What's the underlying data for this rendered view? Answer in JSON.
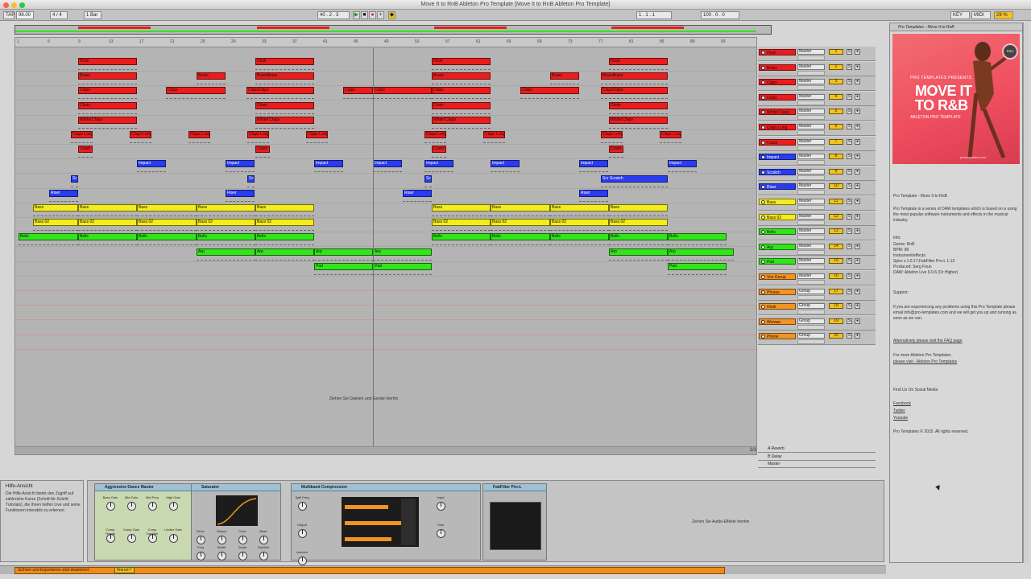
{
  "window": {
    "title": "Move It to RnB Ableton Pro Template  [Move It to RnB Ableton Pro Template]"
  },
  "transport": {
    "tap": "TAP",
    "tempo": "98.00",
    "meter": "4 / 4",
    "quantize": "1 Bar",
    "position": "40 . 2 . 3",
    "loop_start": "1 . 1 . 1",
    "loop_length": "100 . 0 . 0",
    "key": "KEY",
    "midi": "MIDI",
    "cpu": "29 %"
  },
  "colors": {
    "red": "#ec1c1c",
    "blue": "#2a3cf0",
    "yellow": "#f4ec1c",
    "green": "#33e31c",
    "orange": "#f29322"
  },
  "ruler_ticks": [
    "1",
    "5",
    "9",
    "13",
    "17",
    "21",
    "25",
    "29",
    "33",
    "37",
    "41",
    "45",
    "49",
    "53",
    "57",
    "61",
    "65",
    "69",
    "73",
    "77",
    "81",
    "85",
    "89",
    "93"
  ],
  "clips_by_track": [
    [
      [
        "Hook",
        96,
        169
      ],
      [
        "Hook",
        316,
        389
      ],
      [
        "Hook",
        535,
        608
      ],
      [
        "Hook",
        755,
        828
      ]
    ],
    [
      [
        "Brass",
        96,
        169
      ],
      [
        "Brass",
        243,
        279
      ],
      [
        "BrassBrass",
        316,
        389
      ],
      [
        "Brass",
        535,
        608
      ],
      [
        "Brass",
        682,
        718
      ],
      [
        "BrassBrass",
        745,
        828
      ]
    ],
    [
      [
        "Claps",
        96,
        169
      ],
      [
        "Claps",
        205,
        279
      ],
      [
        "ClapsClaps",
        305,
        389
      ],
      [
        "Claps",
        425,
        462
      ],
      [
        "Claps",
        462,
        535
      ],
      [
        "Claps",
        535,
        608
      ],
      [
        "Claps",
        645,
        718
      ],
      [
        "ClapsClaps",
        745,
        828
      ]
    ],
    [
      [
        "Chois",
        96,
        169
      ],
      [
        "Chois",
        316,
        389
      ],
      [
        "Chois",
        535,
        608
      ],
      [
        "Chois",
        755,
        828
      ]
    ],
    [
      [
        "Whitel Claps",
        96,
        169
      ],
      [
        "Whitel Claps",
        316,
        389
      ],
      [
        "Whitel Claps",
        535,
        608
      ],
      [
        "Whitel Claps",
        755,
        828
      ]
    ],
    [
      [
        "Claps Long",
        87,
        114
      ],
      [
        "Claps Long",
        160,
        187
      ],
      [
        "Claps Long",
        233,
        260
      ],
      [
        "Claps Long",
        306,
        333
      ],
      [
        "Claps Long",
        379,
        406
      ],
      [
        "Claps Long",
        526,
        553
      ],
      [
        "Claps Long",
        599,
        626
      ],
      [
        "Claps Long",
        745,
        772
      ],
      [
        "Claps Long",
        818,
        845
      ]
    ],
    [
      [
        "Crash",
        96,
        114
      ],
      [
        "Crash",
        316,
        334
      ],
      [
        "Crash",
        535,
        553
      ],
      [
        "Crash",
        755,
        773
      ]
    ],
    [
      [
        "Impact",
        169,
        205
      ],
      [
        "Impact",
        279,
        315
      ],
      [
        "Impact",
        389,
        425
      ],
      [
        "Impact",
        462,
        498
      ],
      [
        "Impact",
        526,
        562
      ],
      [
        "Impact",
        608,
        644
      ],
      [
        "Impact",
        718,
        754
      ],
      [
        "Impact",
        828,
        864
      ]
    ],
    [
      [
        "Scr",
        87,
        96
      ],
      [
        "Scr",
        306,
        315
      ],
      [
        "Scr",
        526,
        535
      ],
      [
        "Scr Scratch",
        745,
        828
      ]
    ],
    [
      [
        "Riser",
        60,
        96
      ],
      [
        "Riser",
        279,
        315
      ],
      [
        "Riser",
        499,
        535
      ],
      [
        "Riser",
        718,
        754
      ]
    ],
    [
      [
        "Bass",
        40,
        96
      ],
      [
        "Bass",
        96,
        169
      ],
      [
        "Bass",
        169,
        243
      ],
      [
        "Bass",
        243,
        316
      ],
      [
        "Bass",
        316,
        389
      ],
      [
        "Bass",
        535,
        608
      ],
      [
        "Bass",
        608,
        682
      ],
      [
        "Bass",
        682,
        755
      ],
      [
        "Bass",
        755,
        828
      ]
    ],
    [
      [
        "Bass 02",
        40,
        96
      ],
      [
        "Bass 02",
        96,
        169
      ],
      [
        "Bass 02",
        169,
        243
      ],
      [
        "Bass 02",
        243,
        316
      ],
      [
        "Bass 02",
        316,
        389
      ],
      [
        "Bass 02",
        535,
        608
      ],
      [
        "Bass 02",
        608,
        682
      ],
      [
        "Bass 02",
        682,
        755
      ],
      [
        "Bass 02",
        755,
        828
      ]
    ],
    [
      [
        "Bells",
        22,
        96
      ],
      [
        "Bells",
        96,
        169
      ],
      [
        "Bells",
        169,
        243
      ],
      [
        "Bells",
        243,
        316
      ],
      [
        "Bells",
        316,
        389
      ],
      [
        "Bells",
        535,
        608
      ],
      [
        "Bells",
        608,
        682
      ],
      [
        "Bells",
        682,
        755
      ],
      [
        "Bells",
        755,
        828
      ],
      [
        "Bells",
        828,
        901
      ]
    ],
    [
      [
        "Arp",
        243,
        316
      ],
      [
        "Arp",
        316,
        389
      ],
      [
        "Arp",
        389,
        462
      ],
      [
        "Arp",
        462,
        535
      ],
      [
        "Arp",
        755,
        828
      ],
      [
        "Arp",
        828,
        910
      ]
    ],
    [
      [
        "Pad",
        389,
        462
      ],
      [
        "Pad",
        462,
        535
      ],
      [
        "Pad",
        828,
        901
      ]
    ]
  ],
  "tracks": [
    {
      "name": "Hook",
      "color": "#ec1c1c",
      "route": "Master",
      "num": "1"
    },
    {
      "name": "Brass",
      "color": "#ec1c1c",
      "route": "Master",
      "num": "2"
    },
    {
      "name": "Claps",
      "color": "#ec1c1c",
      "route": "Master",
      "num": "3"
    },
    {
      "name": "Chois",
      "color": "#ec1c1c",
      "route": "Master",
      "num": "4"
    },
    {
      "name": "Whitel Claps",
      "color": "#ec1c1c",
      "route": "Master",
      "num": "5"
    },
    {
      "name": "Claps Long",
      "color": "#ec1c1c",
      "route": "Master",
      "num": "6"
    },
    {
      "name": "Crash",
      "color": "#ec1c1c",
      "route": "Master",
      "num": "7"
    },
    {
      "name": "Impact",
      "color": "#2a3cf0",
      "route": "Master",
      "num": "8"
    },
    {
      "name": "Scratch",
      "color": "#2a3cf0",
      "route": "Master",
      "num": "9"
    },
    {
      "name": "Riser",
      "color": "#2a3cf0",
      "route": "Master",
      "num": "10"
    },
    {
      "name": "Bass",
      "color": "#f4ec1c",
      "route": "Master",
      "num": "11"
    },
    {
      "name": "Bass 02",
      "color": "#f4ec1c",
      "route": "Master",
      "num": "12"
    },
    {
      "name": "Bells",
      "color": "#33e31c",
      "route": "Master",
      "num": "13"
    },
    {
      "name": "Arp",
      "color": "#33e31c",
      "route": "Master",
      "num": "14"
    },
    {
      "name": "Pad",
      "color": "#33e31c",
      "route": "Master",
      "num": "15"
    },
    {
      "name": "Vox Group",
      "color": "#f29322",
      "route": "Master",
      "num": "16"
    },
    {
      "name": "Phrase",
      "color": "#f29322",
      "route": "Group",
      "num": "17"
    },
    {
      "name": "Hook",
      "color": "#f29322",
      "route": "Group",
      "num": "18"
    },
    {
      "name": "Woman",
      "color": "#f29322",
      "route": "Group",
      "num": "19"
    },
    {
      "name": "Phone",
      "color": "#f29322",
      "route": "Group",
      "num": "20"
    }
  ],
  "returns": [
    {
      "name": "A Reverb",
      "num": "A"
    },
    {
      "name": "B Delay",
      "num": "B"
    },
    {
      "name": "Master",
      "num": ""
    }
  ],
  "arrangement": {
    "drop_hint": "Ziehen Sie Dateien und Geräte hierhin",
    "page": "1/1"
  },
  "info": {
    "title": "Hilfe-Ansicht",
    "body": "Die Hilfe-Ansicht bietet den Zugriff auf zahlreiche Kurse (Schritt-für-Schritt Tutorials), die Ihnen helfen Live und seine Funktionen interaktiv zu erlernen."
  },
  "devices": [
    {
      "name": "Aggressive Dance Master",
      "knobs": [
        "Bass Gain",
        "Mid Gain",
        "Mid Freq",
        "High Gain",
        "Comp Thresh",
        "Comp Gain",
        "Comp Dry/Wet",
        "Limiter Gain"
      ]
    },
    {
      "name": "Saturator",
      "knobs": [
        "Drive",
        "Output",
        "Color",
        "Base",
        "Freq",
        "Width",
        "Depth",
        "Dry/Wet"
      ]
    },
    {
      "name": "Multiband Compression",
      "knobs": [
        "Split Freq",
        "Input",
        "Output",
        "Time",
        "Amount"
      ]
    },
    {
      "name": "FabFilter Pro-L",
      "knobs": []
    }
  ],
  "devices_hint": "Ziehen Sie Audio-Effekte hierhin",
  "status": {
    "message": "Sichern und Exportieren sind deaktiviert",
    "link": "Warum?"
  },
  "sidebar": {
    "header": "Pro Templates - Move It to RnB",
    "promo": {
      "small": "PRO TEMPLATES PRESENTS",
      "big1": "MOVE IT",
      "big2": "TO R&B",
      "sub": "ABLETON PRO TEMPLATE",
      "logo": "PRO",
      "url": "protemplates.com"
    },
    "heading": "Pro Template - Move It to RnB",
    "desc": "Pro Template is a series of DAW templates which is based on a using the most popular software instruments and effects in the musical industry.",
    "info_label": "Info:",
    "info_lines": [
      "Genre: RnB",
      "BPM: 98",
      "Instrument/effects:",
      "Spire v.1.0.17,FabFilter Pro-L 1.13",
      "Produced: Serg Foun",
      "DAW: Ableton Live 9.0.6 (Or Higher)"
    ],
    "support_label": "Support:",
    "support": "If you are experiencing any problems using this Pro Template please email info@pro-templates.com and we will get you up and running as soon as we can.",
    "faq": "Alternatively please visit the FAQ page",
    "more1": "For more Ableton Pro Templates",
    "more2": "please visit - Ableton Pro Templates",
    "social": "Find Us On Social Media",
    "links": [
      "Facebook",
      "Twitter",
      "Youtube"
    ],
    "copyright": "Pro Templates © 2015. All rights reserved."
  }
}
